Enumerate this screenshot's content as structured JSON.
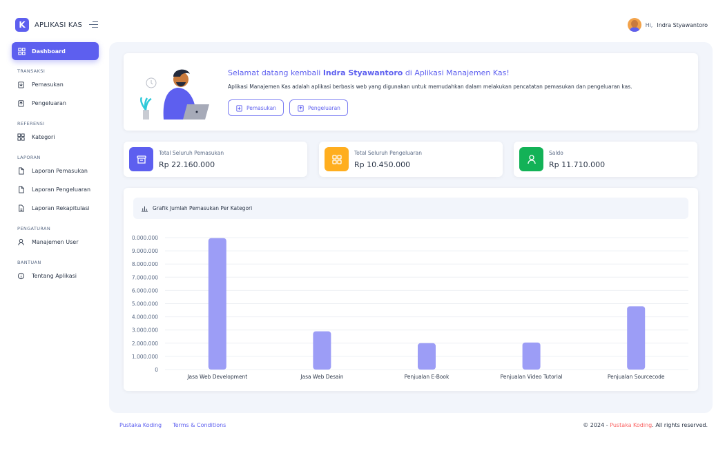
{
  "brand": {
    "logo_letter": "K",
    "name": "APLIKASI KAS"
  },
  "user": {
    "greeting": "Hi,",
    "name": "Indra Styawantoro"
  },
  "sidebar": {
    "active": {
      "label": "Dashboard",
      "icon": "dashboard-icon"
    },
    "sections": [
      {
        "title": "TRANSAKSI",
        "items": [
          {
            "label": "Pemasukan",
            "icon": "income-icon"
          },
          {
            "label": "Pengeluaran",
            "icon": "expense-icon"
          }
        ]
      },
      {
        "title": "REFERENSI",
        "items": [
          {
            "label": "Kategori",
            "icon": "category-icon"
          }
        ]
      },
      {
        "title": "LAPORAN",
        "items": [
          {
            "label": "Laporan Pemasukan",
            "icon": "file-icon"
          },
          {
            "label": "Laporan Pengeluaran",
            "icon": "file-icon"
          },
          {
            "label": "Laporan Rekapitulasi",
            "icon": "file-text-icon"
          }
        ]
      },
      {
        "title": "PENGATURAN",
        "items": [
          {
            "label": "Manajemen User",
            "icon": "user-icon"
          }
        ]
      },
      {
        "title": "BANTUAN",
        "items": [
          {
            "label": "Tentang Aplikasi",
            "icon": "info-icon"
          }
        ]
      }
    ]
  },
  "welcome": {
    "title_prefix": "Selamat datang kembali",
    "title_name": "Indra Styawantoro",
    "title_mid": "di",
    "title_app": "Aplikasi Manajemen Kas!",
    "description": "Aplikasi Manajemen Kas adalah aplikasi berbasis web yang digunakan untuk memudahkan dalam melakukan pencatatan pemasukan dan pengeluaran kas.",
    "btn_income": "Pemasukan",
    "btn_expense": "Pengeluaran"
  },
  "stats": [
    {
      "label": "Total Seluruh Pemasukan",
      "value": "Rp 22.160.000",
      "color": "#5d5fef",
      "icon": "archive-icon"
    },
    {
      "label": "Total Seluruh Pengeluaran",
      "value": "Rp 10.450.000",
      "color": "#ffae1f",
      "icon": "grid-icon"
    },
    {
      "label": "Saldo",
      "value": "Rp 11.710.000",
      "color": "#13b257",
      "icon": "user-icon"
    }
  ],
  "chart_title": "Grafik Jumlah Pemasukan Per Kategori",
  "chart_data": {
    "type": "bar",
    "categories": [
      "Jasa Web Development",
      "Jasa Web Desain",
      "Penjualan E-Book",
      "Penjualan Video Tutorial",
      "Penjualan Sourcecode"
    ],
    "values": [
      9960000,
      2900000,
      2000000,
      2050000,
      4800000
    ],
    "ylim": [
      0,
      10000000
    ],
    "yticks": [
      "0",
      "1.000.000",
      "2.000.000",
      "3.000.000",
      "4.000.000",
      "5.000.000",
      "6.000.000",
      "7.000.000",
      "8.000.000",
      "9.000.000",
      "0.000.000"
    ],
    "bar_color": "#9c9df6",
    "grid": true
  },
  "footer": {
    "link1": "Pustaka Koding",
    "link2": "Terms & Conditions",
    "copyright_prefix": "© 2024 -",
    "copyright_brand": "Pustaka Koding",
    "copyright_suffix": ". All rights reserved."
  }
}
